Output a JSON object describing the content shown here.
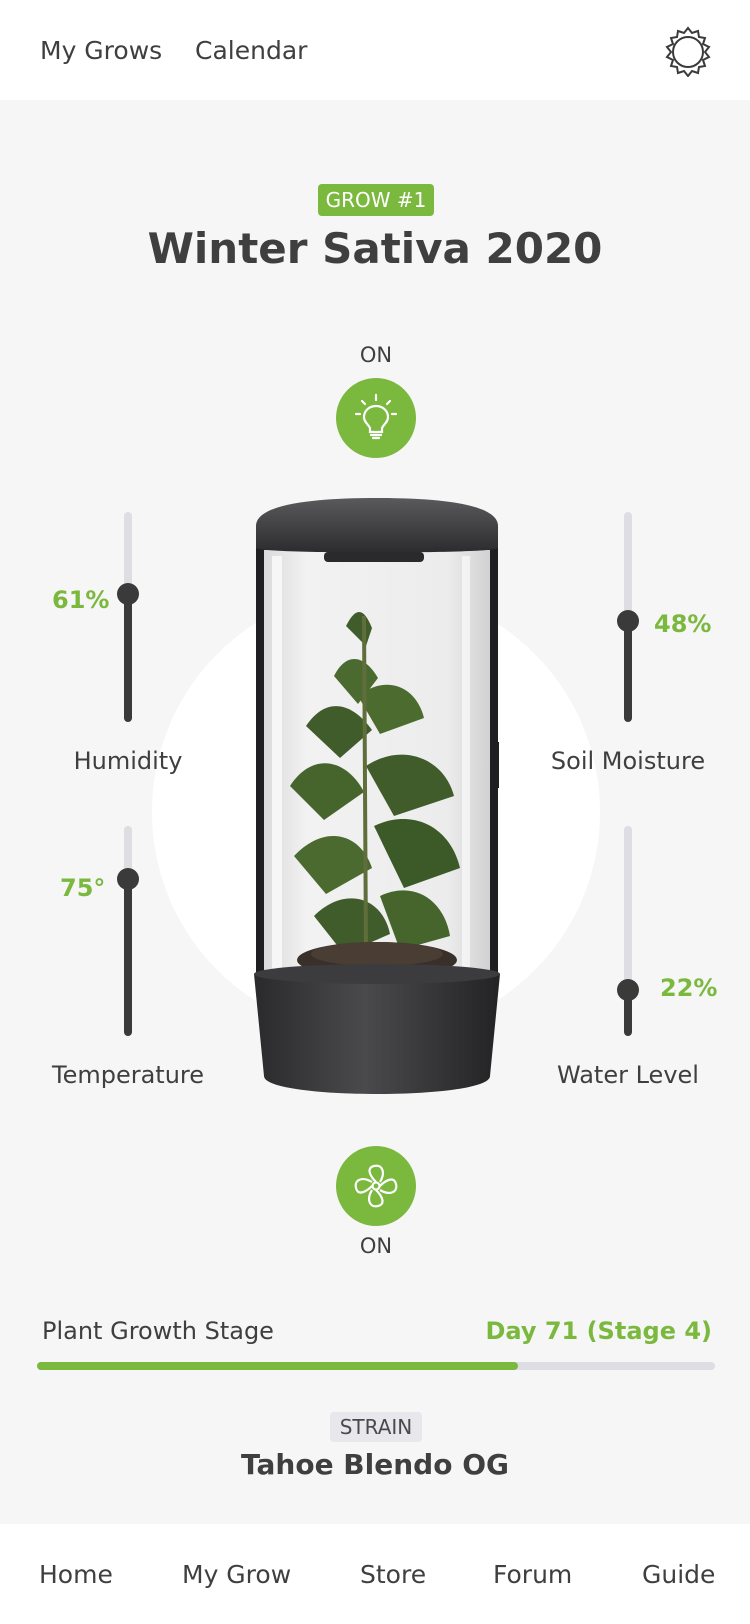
{
  "topnav": {
    "my_grows": "My Grows",
    "calendar": "Calendar",
    "settings_icon": "gear-icon"
  },
  "grow": {
    "badge": "GROW #1",
    "title": "Winter Sativa 2020"
  },
  "light": {
    "status": "ON",
    "icon": "lightbulb-icon",
    "color": "#7ab83e"
  },
  "fan": {
    "status": "ON",
    "icon": "fan-icon"
  },
  "sensors": {
    "humidity": {
      "label": "Humidity",
      "display": "61%",
      "level": 0.61
    },
    "temperature": {
      "label": "Temperature",
      "display": "75°",
      "level": 0.75
    },
    "soil_moisture": {
      "label": "Soil Moisture",
      "display": "48%",
      "level": 0.48
    },
    "water_level": {
      "label": "Water Level",
      "display": "22%",
      "level": 0.22
    }
  },
  "growth": {
    "label": "Plant Growth Stage",
    "day": "Day 71 (Stage 4)",
    "progress": 0.71
  },
  "strain": {
    "tag": "STRAIN",
    "name": "Tahoe Blendo OG"
  },
  "bottom_tabs": [
    {
      "label": "Home"
    },
    {
      "label": "My Grow"
    },
    {
      "label": "Store"
    },
    {
      "label": "Forum"
    },
    {
      "label": "Guide"
    }
  ],
  "colors": {
    "accent": "#7ab83e",
    "track": "#dedde3",
    "dark": "#3a3a3a"
  }
}
